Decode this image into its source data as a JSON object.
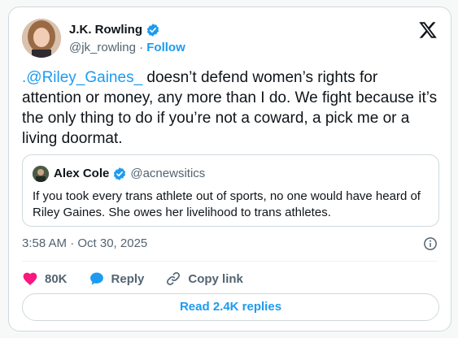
{
  "author": {
    "name": "J.K. Rowling",
    "handle": "@jk_rowling",
    "separator": "·",
    "follow_label": "Follow"
  },
  "tweet": {
    "mention": ".@Riley_Gaines_",
    "text": " doesn’t defend women’s rights for attention or money, any more than I do. We fight because it’s the only thing to do if you’re not a coward, a pick me or a living doormat."
  },
  "quote": {
    "name": "Alex Cole",
    "handle": "@acnewsitics",
    "text": "If you took every trans athlete out of sports, no one would have heard of Riley Gaines. She owes her livelihood to trans athletes."
  },
  "meta": {
    "timestamp": "3:58 AM · Oct 30, 2025"
  },
  "actions": {
    "likes": "80K",
    "reply_label": "Reply",
    "copy_link_label": "Copy link"
  },
  "replies_button": {
    "label": "Read 2.4K replies"
  },
  "colors": {
    "accent": "#1d9bf0",
    "like": "#f91880",
    "muted": "#536471",
    "border": "#cfd9de"
  },
  "icons": [
    "verified-badge-icon",
    "x-logo-icon",
    "info-icon",
    "heart-icon",
    "reply-bubble-icon",
    "link-icon"
  ]
}
